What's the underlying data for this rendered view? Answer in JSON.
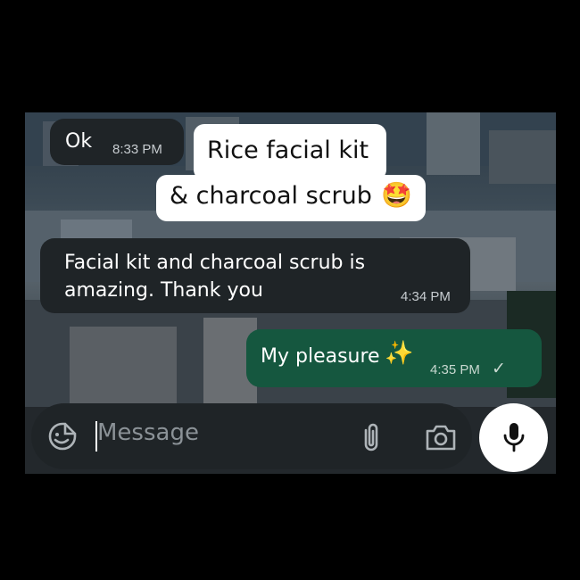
{
  "messages": [
    {
      "text": "Ok",
      "time": "8:33 PM",
      "direction": "incoming"
    },
    {
      "text": "Facial kit and charcoal scrub is amazing. Thank you",
      "line1": "Facial kit and charcoal scrub is",
      "line2": "amazing. Thank you",
      "time": "4:34 PM",
      "direction": "incoming"
    },
    {
      "text": "My pleasure",
      "emoji": "✨",
      "time": "4:35 PM",
      "status": "✓",
      "direction": "outgoing"
    }
  ],
  "sticker": {
    "line1": "Rice facial kit",
    "line2": "& charcoal scrub",
    "emoji": "🤩"
  },
  "composer": {
    "placeholder": "Message"
  },
  "icons": [
    "sticker-icon",
    "attach-icon",
    "camera-icon",
    "mic-icon"
  ],
  "colors": {
    "incoming_bubble": "#1f2427",
    "outgoing_bubble": "#15573f",
    "input_bar": "#1f2427",
    "mic_button": "#ffffff"
  }
}
